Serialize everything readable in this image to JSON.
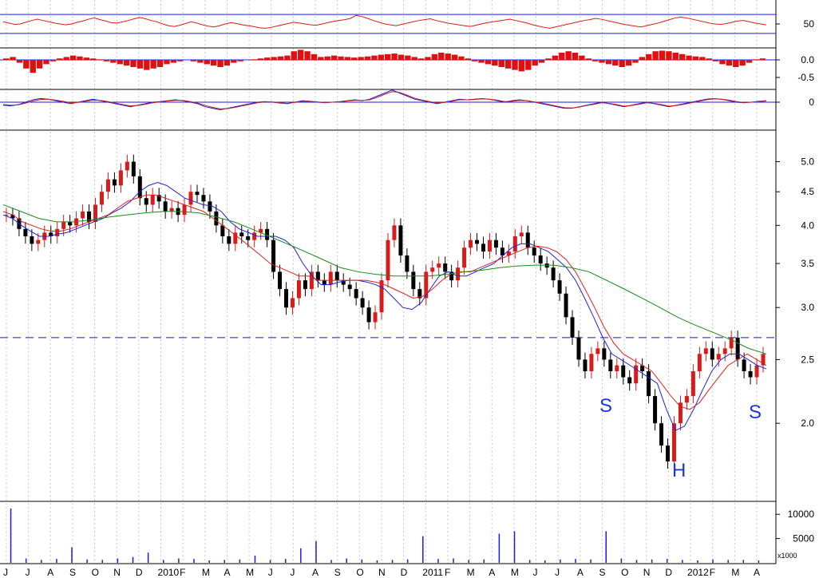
{
  "chart_data": [
    {
      "type": "line",
      "panel": "oscillator",
      "yticks": [
        50
      ],
      "reference_lines": [
        72,
        28
      ],
      "series": [
        {
          "color": "#d81b1b",
          "values": [
            55,
            52,
            49,
            50,
            54,
            58,
            61,
            58,
            55,
            52,
            50,
            48,
            50,
            54,
            57,
            61,
            64,
            60,
            57,
            53,
            52,
            55,
            58,
            62,
            65,
            62,
            58,
            55,
            50,
            46,
            44,
            47,
            51,
            55,
            52,
            48,
            45,
            43,
            46,
            50,
            53,
            51,
            48,
            46,
            44,
            41,
            40,
            42,
            45,
            48,
            51,
            54,
            52,
            50,
            48,
            47,
            50,
            53,
            56,
            58,
            60,
            63,
            70,
            67,
            63,
            58,
            54,
            50,
            48,
            46,
            49,
            52,
            55,
            58,
            60,
            62,
            58,
            55,
            52,
            50,
            48,
            46,
            44,
            47,
            50,
            53,
            55,
            57,
            59,
            61,
            58,
            55,
            52,
            48,
            45,
            42,
            40,
            43,
            46,
            49,
            52,
            55,
            58,
            60,
            63,
            61,
            58,
            55,
            52,
            49,
            47,
            45,
            43,
            46,
            49,
            52,
            56,
            60,
            64,
            66,
            64,
            61,
            58,
            55,
            52,
            50,
            49,
            51,
            54,
            57,
            58,
            55,
            52,
            50,
            48
          ]
        }
      ]
    },
    {
      "type": "bar",
      "panel": "histogram",
      "yticks": [
        0.0,
        -0.5
      ],
      "color": "#e01010",
      "values": [
        0.05,
        0.1,
        -0.1,
        -0.3,
        -0.45,
        -0.3,
        -0.15,
        -0.05,
        0.05,
        0.1,
        0.15,
        0.12,
        0.08,
        0.05,
        0.02,
        -0.05,
        -0.1,
        -0.15,
        -0.2,
        -0.25,
        -0.3,
        -0.35,
        -0.3,
        -0.25,
        -0.15,
        -0.1,
        -0.05,
        0.0,
        -0.05,
        -0.1,
        -0.15,
        -0.2,
        -0.25,
        -0.2,
        -0.1,
        -0.05,
        0.0,
        0.02,
        0.05,
        0.08,
        0.1,
        0.12,
        0.15,
        0.3,
        0.35,
        0.3,
        0.2,
        0.1,
        0.12,
        0.15,
        0.12,
        0.1,
        0.08,
        0.1,
        0.12,
        0.15,
        0.18,
        0.2,
        0.22,
        0.18,
        0.15,
        0.1,
        0.05,
        0.1,
        0.2,
        0.25,
        0.22,
        0.18,
        0.12,
        0.05,
        -0.05,
        -0.1,
        -0.15,
        -0.2,
        -0.25,
        -0.3,
        -0.35,
        -0.4,
        -0.35,
        -0.2,
        -0.1,
        0.05,
        0.15,
        0.25,
        0.3,
        0.25,
        0.15,
        0.05,
        -0.05,
        -0.1,
        -0.15,
        -0.2,
        -0.25,
        -0.2,
        -0.1,
        0.1,
        0.2,
        0.3,
        0.32,
        0.3,
        0.25,
        0.2,
        0.15,
        0.12,
        0.1,
        0.05,
        -0.05,
        -0.15,
        -0.2,
        -0.25,
        -0.2,
        -0.1,
        0.02,
        0.05
      ]
    },
    {
      "type": "line",
      "panel": "macd",
      "yticks": [
        0
      ],
      "series": [
        {
          "color": "#1a1ae0",
          "values": [
            -0.1,
            -0.12,
            -0.08,
            0.0,
            0.08,
            0.12,
            0.1,
            0.05,
            0.0,
            -0.05,
            0.0,
            0.05,
            0.1,
            0.05,
            0.0,
            -0.05,
            -0.1,
            -0.15,
            -0.1,
            -0.05,
            0.0,
            0.02,
            0.05,
            0.08,
            0.05,
            0.0,
            -0.05,
            -0.15,
            -0.2,
            -0.25,
            -0.2,
            -0.15,
            -0.1,
            -0.05,
            0.0,
            0.02,
            0.0,
            -0.03,
            -0.05,
            0.0,
            0.05,
            0.03,
            0.0,
            -0.02,
            0.0,
            0.02,
            0.05,
            0.08,
            0.05,
            0.1,
            0.2,
            0.3,
            0.4,
            0.3,
            0.2,
            0.1,
            0.05,
            0.0,
            -0.05,
            0.0,
            0.05,
            0.1,
            0.08,
            0.1,
            0.12,
            0.1,
            0.05,
            0.0,
            0.05,
            0.08,
            0.05,
            0.0,
            -0.05,
            -0.1,
            -0.15,
            -0.2,
            -0.2,
            -0.15,
            -0.1,
            -0.05,
            0.0,
            -0.05,
            -0.1,
            -0.15,
            -0.1,
            -0.05,
            0.0,
            -0.05,
            -0.1,
            -0.15,
            -0.1,
            -0.05,
            0.0,
            0.05,
            0.1,
            0.12,
            0.1,
            0.05,
            0.0,
            -0.02,
            0.0,
            0.03,
            0.05
          ]
        },
        {
          "color": "#c02020",
          "values": [
            -0.08,
            -0.1,
            -0.09,
            -0.03,
            0.04,
            0.09,
            0.1,
            0.07,
            0.03,
            -0.02,
            -0.01,
            0.03,
            0.07,
            0.06,
            0.02,
            -0.03,
            -0.08,
            -0.12,
            -0.11,
            -0.07,
            -0.02,
            0.01,
            0.04,
            0.06,
            0.06,
            0.02,
            -0.03,
            -0.11,
            -0.17,
            -0.22,
            -0.21,
            -0.17,
            -0.12,
            -0.07,
            -0.02,
            0.01,
            0.01,
            -0.02,
            -0.04,
            -0.01,
            0.03,
            0.03,
            0.01,
            -0.01,
            0.0,
            0.01,
            0.04,
            0.06,
            0.06,
            0.08,
            0.16,
            0.26,
            0.35,
            0.32,
            0.23,
            0.13,
            0.07,
            0.02,
            -0.03,
            -0.01,
            0.03,
            0.08,
            0.08,
            0.09,
            0.11,
            0.1,
            0.07,
            0.02,
            0.03,
            0.06,
            0.05,
            0.01,
            -0.03,
            -0.08,
            -0.13,
            -0.18,
            -0.19,
            -0.16,
            -0.11,
            -0.07,
            -0.02,
            -0.04,
            -0.08,
            -0.13,
            -0.11,
            -0.07,
            -0.02,
            -0.04,
            -0.08,
            -0.13,
            -0.11,
            -0.07,
            -0.02,
            0.03,
            0.08,
            0.11,
            0.1,
            0.07,
            0.02,
            -0.01,
            0.0,
            0.02,
            0.04
          ]
        }
      ]
    },
    {
      "type": "candlestick",
      "panel": "price",
      "scale": "log",
      "yticks": [
        5.0,
        4.5,
        4.0,
        3.5,
        3.0,
        2.5,
        2.0
      ],
      "ylim": [
        1.6,
        5.4
      ],
      "reference_line": 2.7,
      "up_color": "#d81b1b",
      "down_color": "#000000",
      "close": [
        4.15,
        4.1,
        3.95,
        3.85,
        3.75,
        3.8,
        3.9,
        3.85,
        3.95,
        4.05,
        4.0,
        4.1,
        4.2,
        4.05,
        4.3,
        4.5,
        4.7,
        4.6,
        4.85,
        5.0,
        4.75,
        4.4,
        4.3,
        4.45,
        4.35,
        4.2,
        4.25,
        4.15,
        4.3,
        4.5,
        4.45,
        4.35,
        4.2,
        4.0,
        3.85,
        3.75,
        3.9,
        3.85,
        3.8,
        3.9,
        3.95,
        3.8,
        3.4,
        3.2,
        3.0,
        3.1,
        3.3,
        3.2,
        3.4,
        3.3,
        3.25,
        3.4,
        3.3,
        3.25,
        3.2,
        3.1,
        3.0,
        2.85,
        2.95,
        3.3,
        3.8,
        4.0,
        3.6,
        3.4,
        3.2,
        3.1,
        3.4,
        3.45,
        3.5,
        3.4,
        3.3,
        3.45,
        3.7,
        3.8,
        3.75,
        3.65,
        3.8,
        3.7,
        3.6,
        3.65,
        3.85,
        3.9,
        3.7,
        3.6,
        3.5,
        3.45,
        3.3,
        3.15,
        2.9,
        2.7,
        2.5,
        2.4,
        2.55,
        2.6,
        2.5,
        2.4,
        2.45,
        2.35,
        2.3,
        2.45,
        2.4,
        2.2,
        2.0,
        1.85,
        1.75,
        2.0,
        2.15,
        2.2,
        2.4,
        2.55,
        2.6,
        2.5,
        2.55,
        2.6,
        2.7,
        2.5,
        2.4,
        2.35,
        2.45,
        2.55
      ]
    },
    {
      "type": "line",
      "panel": "price",
      "series": [
        {
          "color": "#2020e0",
          "values": [
            4.15,
            4.1,
            4.0,
            3.92,
            3.85,
            3.85,
            3.88,
            3.9,
            3.95,
            4.0,
            4.05,
            4.1,
            4.18,
            4.25,
            4.35,
            4.5,
            4.6,
            4.65,
            4.6,
            4.5,
            4.4,
            4.35,
            4.3,
            4.28,
            4.2,
            4.05,
            3.95,
            3.9,
            3.85,
            3.85,
            3.85,
            3.8,
            3.7,
            3.5,
            3.35,
            3.25,
            3.25,
            3.28,
            3.3,
            3.3,
            3.28,
            3.25,
            3.2,
            3.1,
            3.0,
            2.98,
            3.05,
            3.2,
            3.35,
            3.4,
            3.35,
            3.35,
            3.4,
            3.45,
            3.5,
            3.6,
            3.7,
            3.75,
            3.75,
            3.7,
            3.65,
            3.55,
            3.45,
            3.3,
            3.1,
            2.9,
            2.7,
            2.55,
            2.5,
            2.45,
            2.4,
            2.35,
            2.3,
            2.1,
            1.95,
            1.98,
            2.1,
            2.25,
            2.4,
            2.5,
            2.55,
            2.55,
            2.5,
            2.45,
            2.42
          ]
        },
        {
          "color": "#e02020",
          "values": [
            4.2,
            4.15,
            4.05,
            4.0,
            3.95,
            3.92,
            3.92,
            3.95,
            4.0,
            4.05,
            4.1,
            4.15,
            4.25,
            4.35,
            4.4,
            4.45,
            4.45,
            4.4,
            4.35,
            4.3,
            4.25,
            4.2,
            4.1,
            4.0,
            3.9,
            3.8,
            3.7,
            3.6,
            3.5,
            3.45,
            3.4,
            3.35,
            3.35,
            3.3,
            3.3,
            3.3,
            3.3,
            3.3,
            3.3,
            3.28,
            3.25,
            3.2,
            3.15,
            3.1,
            3.12,
            3.2,
            3.3,
            3.38,
            3.4,
            3.4,
            3.45,
            3.5,
            3.55,
            3.6,
            3.65,
            3.7,
            3.72,
            3.7,
            3.65,
            3.55,
            3.4,
            3.2,
            3.0,
            2.8,
            2.65,
            2.55,
            2.5,
            2.45,
            2.4,
            2.3,
            2.2,
            2.12,
            2.1,
            2.15,
            2.25,
            2.35,
            2.45,
            2.5,
            2.55,
            2.5,
            2.45
          ]
        },
        {
          "color": "#1a8a1a",
          "values": [
            4.3,
            4.2,
            4.1,
            4.05,
            4.05,
            4.08,
            4.12,
            4.15,
            4.18,
            4.2,
            4.2,
            4.18,
            4.12,
            4.05,
            3.95,
            3.85,
            3.75,
            3.65,
            3.55,
            3.45,
            3.4,
            3.37,
            3.35,
            3.35,
            3.35,
            3.37,
            3.4,
            3.42,
            3.45,
            3.47,
            3.48,
            3.48,
            3.45,
            3.4,
            3.3,
            3.2,
            3.1,
            3.0,
            2.9,
            2.82,
            2.75,
            2.68,
            2.6,
            2.55
          ]
        }
      ]
    },
    {
      "type": "bar",
      "panel": "volume",
      "yticks": [
        10000,
        5000
      ],
      "unit_label": "x1000",
      "color": "#1a1ae0",
      "categories": [
        "J",
        "J",
        "A",
        "S",
        "O",
        "N",
        "D",
        "2010",
        "F",
        "M",
        "A",
        "M",
        "J",
        "J",
        "A",
        "S",
        "O",
        "N",
        "D",
        "2011",
        "F",
        "M",
        "A",
        "M",
        "J",
        "J",
        "A",
        "S",
        "O",
        "N",
        "D",
        "2012",
        "F",
        "M",
        "A"
      ],
      "values": [
        11200,
        900,
        600,
        800,
        3200,
        700,
        600,
        900,
        1200,
        2100,
        600,
        900,
        800,
        500,
        600,
        700,
        1500,
        600,
        800,
        3000,
        4500,
        600,
        900,
        700,
        500,
        600,
        700,
        5500,
        800,
        900,
        600,
        700,
        6000,
        6500,
        600,
        500,
        700,
        800,
        700,
        6500,
        900,
        600,
        700,
        800,
        600,
        500,
        700,
        600,
        600,
        500
      ]
    }
  ],
  "annotations": [
    "S",
    "H",
    "S"
  ]
}
